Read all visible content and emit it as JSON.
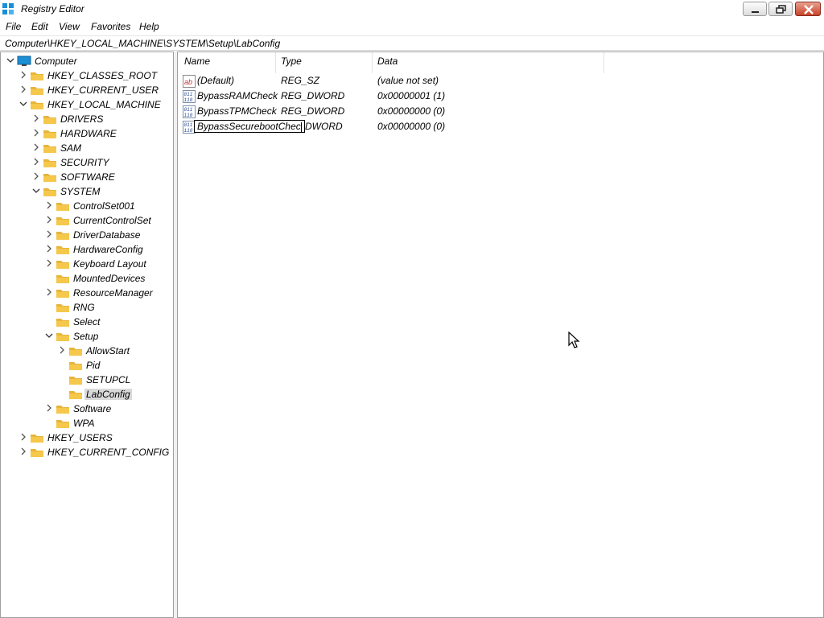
{
  "window": {
    "title": "Registry Editor"
  },
  "menu": [
    "File",
    "Edit",
    "View",
    "Favorites",
    "Help"
  ],
  "address": "Computer\\HKEY_LOCAL_MACHINE\\SYSTEM\\Setup\\LabConfig",
  "tree": {
    "root": "Computer",
    "hives": [
      "HKEY_CLASSES_ROOT",
      "HKEY_CURRENT_USER",
      "HKEY_LOCAL_MACHINE",
      "HKEY_USERS",
      "HKEY_CURRENT_CONFIG"
    ],
    "hklm_children": [
      "DRIVERS",
      "HARDWARE",
      "SAM",
      "SECURITY",
      "SOFTWARE",
      "SYSTEM"
    ],
    "system_children": [
      "ControlSet001",
      "CurrentControlSet",
      "DriverDatabase",
      "HardwareConfig",
      "Keyboard Layout",
      "MountedDevices",
      "ResourceManager",
      "RNG",
      "Select",
      "Setup",
      "Software",
      "WPA"
    ],
    "setup_children": [
      "AllowStart",
      "Pid",
      "SETUPCL",
      "LabConfig"
    ],
    "selected": "LabConfig"
  },
  "list": {
    "columns": [
      "Name",
      "Type",
      "Data"
    ],
    "rows": [
      {
        "name": "(Default)",
        "type": "REG_SZ",
        "data": "(value not set)",
        "icon": "string-value-icon"
      },
      {
        "name": "BypassRAMCheck",
        "type": "REG_DWORD",
        "data": "0x00000001 (1)",
        "icon": "dword-value-icon"
      },
      {
        "name": "BypassTPMCheck",
        "type": "REG_DWORD",
        "data": "0x00000000 (0)",
        "icon": "dword-value-icon"
      },
      {
        "name": "BypassSecurebootChec",
        "type": "DWORD",
        "data": "0x00000000 (0)",
        "icon": "dword-value-icon"
      }
    ],
    "rename_text": "BypassSecurebootChec"
  },
  "colors": {
    "folder": "#f5c84c",
    "monitor": "#1a8fd6",
    "selected_bg": "#d9d9d9"
  }
}
